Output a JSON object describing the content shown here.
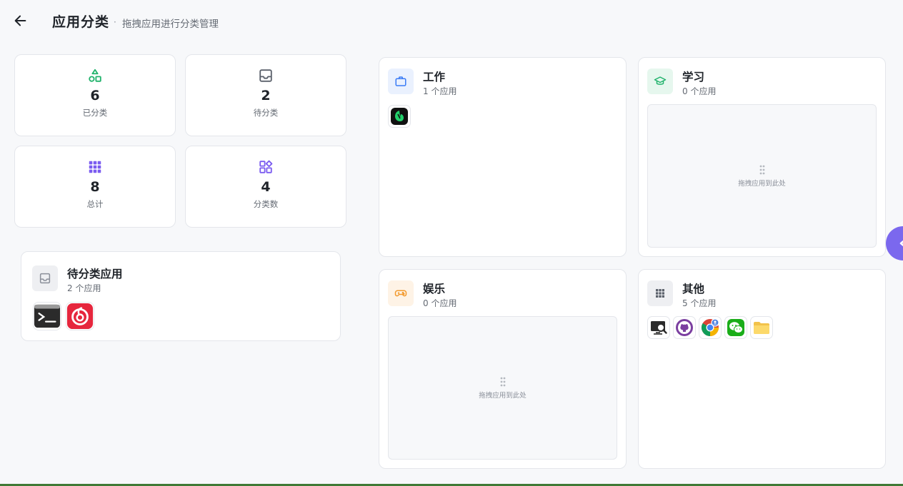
{
  "header": {
    "back_icon": "arrow-left-icon",
    "title": "应用分类",
    "separator": "·",
    "subtitle": "拖拽应用进行分类管理"
  },
  "stats": [
    {
      "value": "6",
      "label": "已分类",
      "icon": "shapes-icon",
      "color": "#21b36c"
    },
    {
      "value": "2",
      "label": "待分类",
      "icon": "inbox-icon",
      "color": "#5b616b"
    },
    {
      "value": "8",
      "label": "总计",
      "icon": "grid-icon",
      "color": "#7b5cf0"
    },
    {
      "value": "4",
      "label": "分类数",
      "icon": "widgets-icon",
      "color": "#7b5cf0"
    }
  ],
  "pending": {
    "title": "待分类应用",
    "count": "2 个应用",
    "apps": [
      {
        "icon": "terminal-icon"
      },
      {
        "icon": "netease-music-icon"
      }
    ]
  },
  "categories": [
    {
      "title": "工作",
      "count": "1 个应用",
      "icon": "briefcase-icon",
      "color": "#3b7cf5",
      "bg": "#eaf1fe",
      "apps": [
        {
          "icon": "evernote-icon"
        }
      ],
      "drop_hint": ""
    },
    {
      "title": "学习",
      "count": "0 个应用",
      "icon": "graduation-cap-icon",
      "color": "#21b36c",
      "bg": "#e6f7ee",
      "apps": [],
      "drop_hint": "拖拽应用到此处"
    },
    {
      "title": "娱乐",
      "count": "0 个应用",
      "icon": "gamepad-icon",
      "color": "#f29a2e",
      "bg": "#fef3e6",
      "apps": [],
      "drop_hint": "拖拽应用到此处"
    },
    {
      "title": "其他",
      "count": "5 个应用",
      "icon": "grid-icon",
      "color": "#5b616b",
      "bg": "#eeeff2",
      "apps": [
        {
          "icon": "screen-viewer-icon"
        },
        {
          "icon": "github-icon"
        },
        {
          "icon": "chrome-icon"
        },
        {
          "icon": "wechat-icon"
        },
        {
          "icon": "folder-icon"
        }
      ],
      "drop_hint": ""
    }
  ],
  "float_button": {
    "icon": "chevron-left-icon",
    "color": "#7b68ee"
  }
}
